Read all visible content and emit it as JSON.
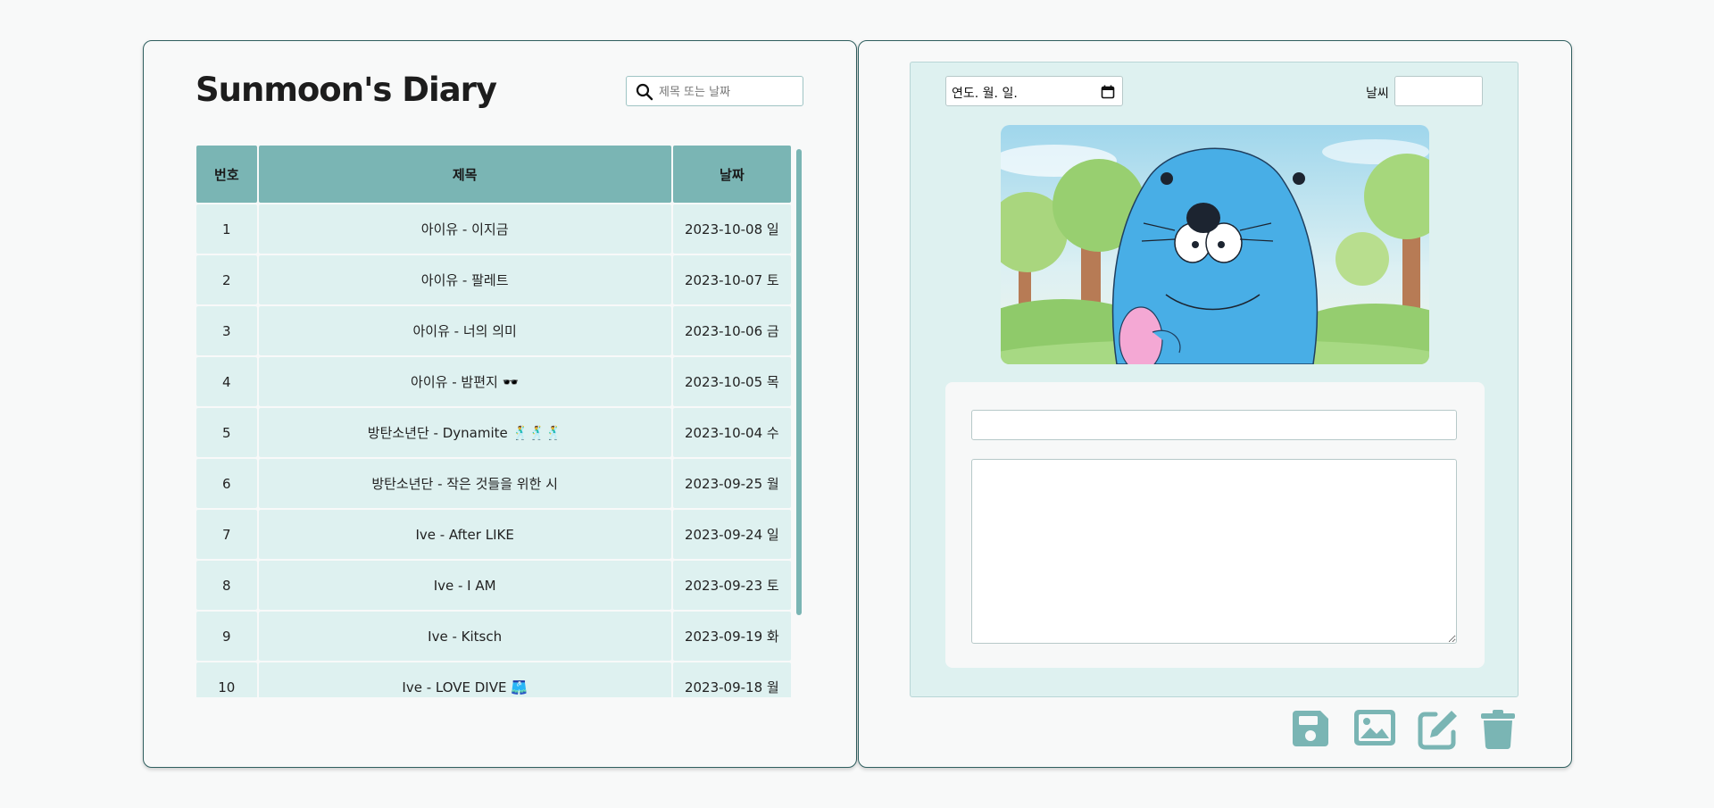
{
  "diary_list": {
    "title": "Sunmoon's Diary",
    "search": {
      "placeholder": "제목 또는 날짜",
      "value": ""
    },
    "columns": [
      "번호",
      "제목",
      "날짜"
    ],
    "rows": [
      {
        "no": "1",
        "title": "아이유 - 이지금",
        "date": "2023-10-08 일"
      },
      {
        "no": "2",
        "title": "아이유 - 팔레트",
        "date": "2023-10-07 토"
      },
      {
        "no": "3",
        "title": "아이유 - 너의 의미",
        "date": "2023-10-06 금"
      },
      {
        "no": "4",
        "title": "아이유 - 밤편지 🕶️",
        "date": "2023-10-05 목"
      },
      {
        "no": "5",
        "title": "방탄소년단 - Dynamite 🕺🕺🕺",
        "date": "2023-10-04 수"
      },
      {
        "no": "6",
        "title": "방탄소년단 - 작은 것들을 위한 시",
        "date": "2023-09-25 월"
      },
      {
        "no": "7",
        "title": "Ive - After LIKE",
        "date": "2023-09-24 일"
      },
      {
        "no": "8",
        "title": "Ive - I AM",
        "date": "2023-09-23 토"
      },
      {
        "no": "9",
        "title": "Ive - Kitsch",
        "date": "2023-09-19 화"
      },
      {
        "no": "10",
        "title": "Ive - LOVE DIVE 🩳",
        "date": "2023-09-18 월"
      }
    ]
  },
  "editor": {
    "date_input": {
      "text": "연도. 월. 일."
    },
    "weather": {
      "label": "날씨",
      "value": ""
    },
    "photo_icon": "cartoon-seal-image",
    "title_field": {
      "value": ""
    },
    "content_field": {
      "value": ""
    },
    "actions": [
      {
        "name": "save",
        "icon": "floppy-disk-icon"
      },
      {
        "name": "image",
        "icon": "image-icon"
      },
      {
        "name": "edit",
        "icon": "pen-square-icon"
      },
      {
        "name": "delete",
        "icon": "trash-icon"
      }
    ]
  },
  "colors": {
    "accent": "#7ab5b4",
    "row_bg": "#def1f0",
    "panel_border": "#2f5f5f"
  }
}
